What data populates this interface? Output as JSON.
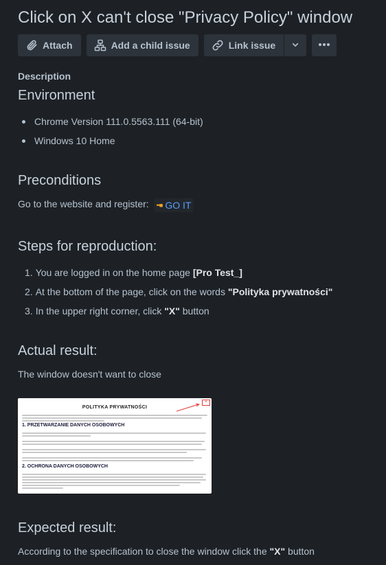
{
  "issue": {
    "title": "Click on X can't close \"Privacy Policy\" window"
  },
  "toolbar": {
    "attach_label": "Attach",
    "child_issue_label": "Add a child issue",
    "link_issue_label": "Link issue"
  },
  "description": {
    "label": "Description",
    "environment": {
      "heading": "Environment",
      "items": [
        "Chrome Version 111.0.5563.111 (64-bit)",
        "Windows 10 Home"
      ]
    },
    "preconditions": {
      "heading": "Preconditions",
      "text": "Go to the website and register:",
      "link_label": "GO IT"
    },
    "steps": {
      "heading": "Steps for reproduction:",
      "items": [
        {
          "num": "1.",
          "pre": "You are logged in on the home page ",
          "strong": "[Pro Test_]",
          "post": ""
        },
        {
          "num": "2.",
          "pre": "At the bottom of the page, click on the words ",
          "strong": "\"Polityka prywatności\"",
          "post": ""
        },
        {
          "num": "3.",
          "pre": "In the upper right corner, click ",
          "strong": "\"X\"",
          "post": " button"
        }
      ]
    },
    "actual": {
      "heading": "Actual result:",
      "text": "The window doesn't want to close",
      "screenshot": {
        "title": "POLITYKA PRYWATNOŚCI",
        "section1": "1. PRZETWARZANIE DANYCH OSOBOWYCH",
        "section2": "2. OCHRONA DANYCH OSOBOWYCH",
        "close_glyph": "×"
      }
    },
    "expected": {
      "heading": "Expected result:",
      "pre": "According to the specification to close the window click the ",
      "strong": "\"X\"",
      "post": " button"
    }
  },
  "icons": [
    "paperclip-icon",
    "hierarchy-icon",
    "link-icon",
    "chevron-down-icon",
    "more-icon"
  ],
  "colors": {
    "background": "#1d2125",
    "text": "#b6c2cf",
    "button": "#2c333a",
    "link": "#579dff"
  }
}
